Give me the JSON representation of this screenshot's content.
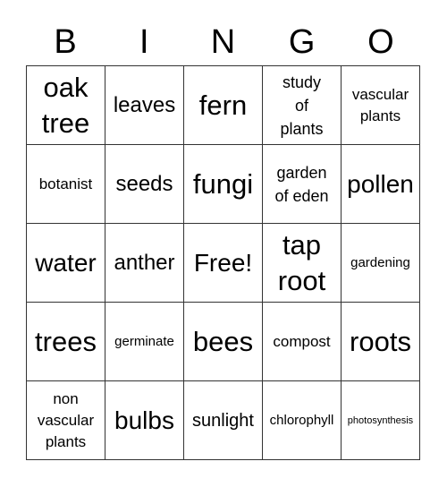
{
  "header": {
    "letters": [
      "B",
      "I",
      "N",
      "G",
      "O"
    ]
  },
  "cells": [
    [
      "oak tree",
      "leaves",
      "fern",
      "study of plants",
      "vascular plants"
    ],
    [
      "botanist",
      "seeds",
      "fungi",
      "garden of eden",
      "pollen"
    ],
    [
      "water",
      "anther",
      "Free!",
      "tap root",
      "gardening"
    ],
    [
      "trees",
      "germinate",
      "bees",
      "compost",
      "roots"
    ],
    [
      "non vascular plants",
      "bulbs",
      "sunlight",
      "chlorophyll",
      "photosynthesis"
    ]
  ],
  "display": [
    [
      [
        "oak",
        "tree"
      ],
      [
        "leaves"
      ],
      [
        "fern"
      ],
      [
        "study",
        "of",
        "plants"
      ],
      [
        "vascular",
        "plants"
      ]
    ],
    [
      [
        "botanist"
      ],
      [
        "seeds"
      ],
      [
        "fungi"
      ],
      [
        "garden",
        "of eden"
      ],
      [
        "pollen"
      ]
    ],
    [
      [
        "water"
      ],
      [
        "anther"
      ],
      [
        "Free!"
      ],
      [
        "tap",
        "root"
      ],
      [
        "gardening"
      ]
    ],
    [
      [
        "trees"
      ],
      [
        "germinate"
      ],
      [
        "bees"
      ],
      [
        "compost"
      ],
      [
        "roots"
      ]
    ],
    [
      [
        "non",
        "vascular",
        "plants"
      ],
      [
        "bulbs"
      ],
      [
        "sunlight"
      ],
      [
        "chlorophyll"
      ],
      [
        "photosynthesis"
      ]
    ]
  ]
}
